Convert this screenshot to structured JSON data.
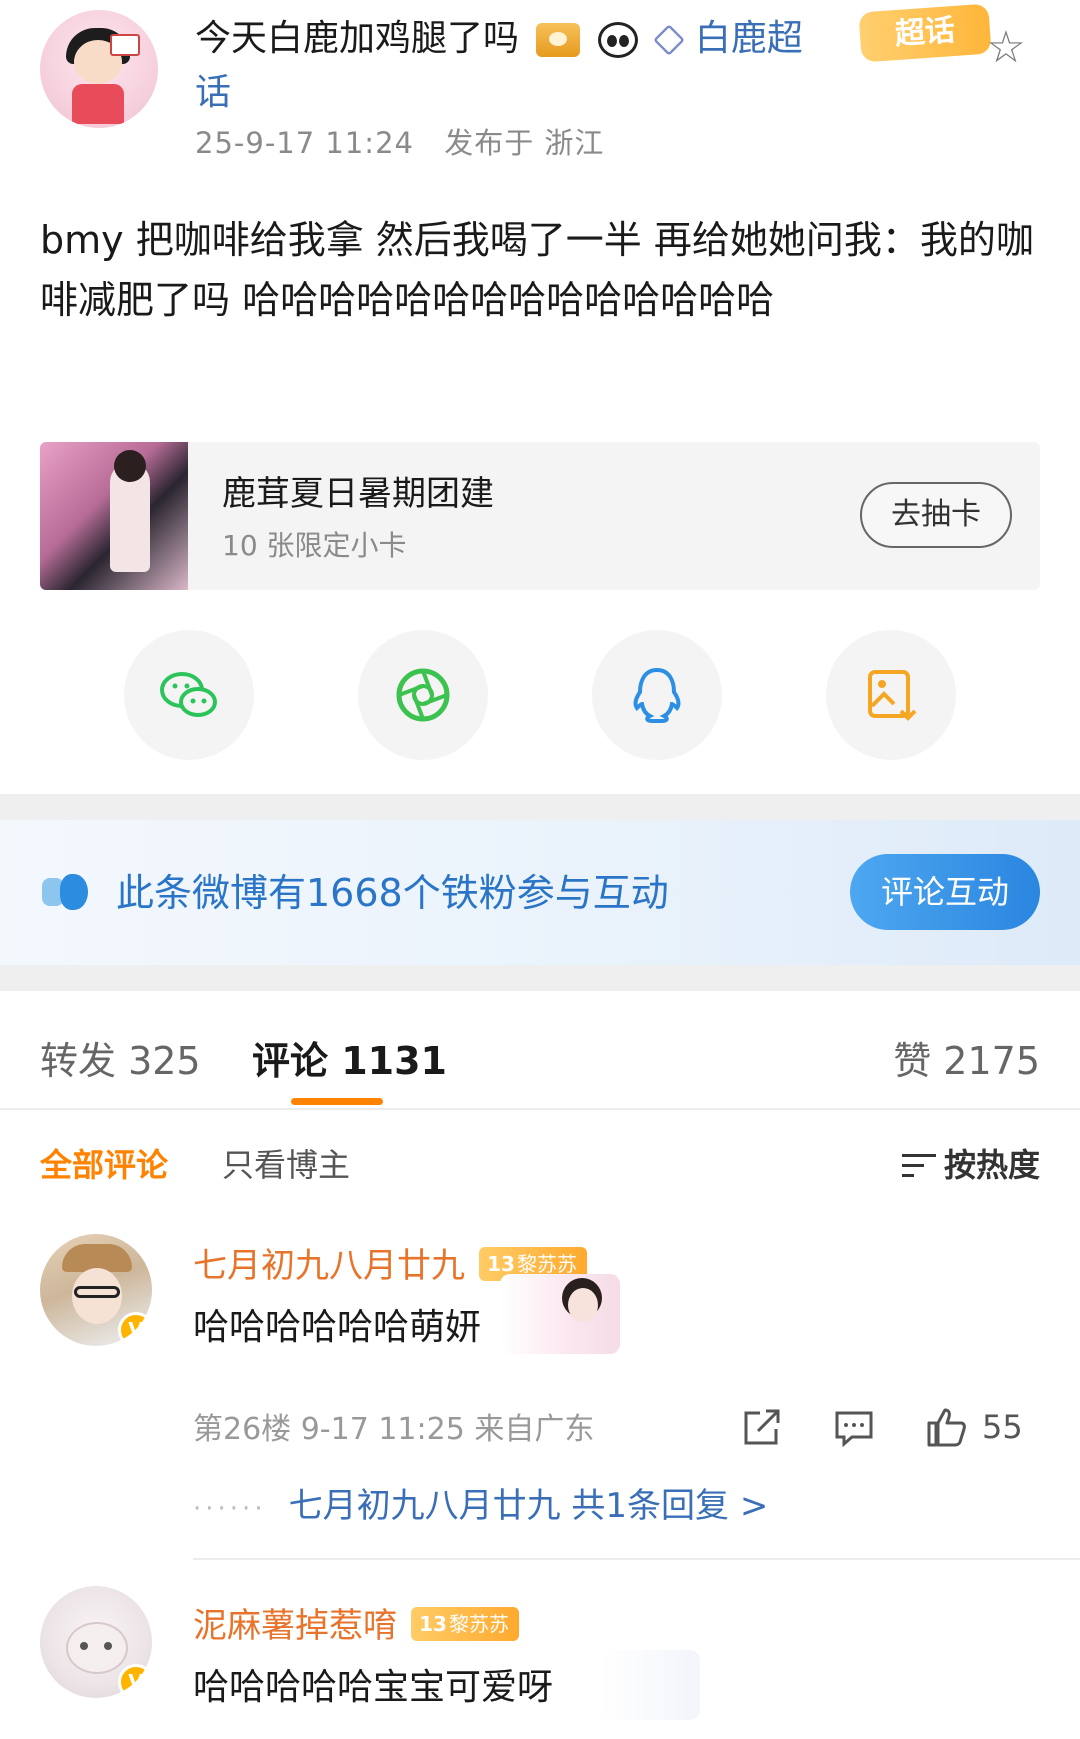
{
  "post": {
    "username": "今天白鹿加鸡腿了吗",
    "topic_link_line1": "白鹿超",
    "topic_link_line2": "话",
    "supertag": "超话",
    "timestamp": "25-9-17 11:24",
    "location": "发布于 浙江",
    "body": "bmy 把咖啡给我拿 然后我喝了一半 再给她她问我：我的咖啡减肥了吗 哈哈哈哈哈哈哈哈哈哈哈哈哈哈"
  },
  "promo": {
    "title": "鹿茸夏日暑期团建",
    "subtitle": "10 张限定小卡",
    "button": "去抽卡"
  },
  "share": {
    "icons": [
      "wechat-icon",
      "moments-icon",
      "qq-icon",
      "save-image-icon"
    ],
    "colors": {
      "wechat": "#2bc45a",
      "moments": "#3cc24e",
      "qq": "#2c8fe4",
      "save": "#f5a623"
    }
  },
  "fans_banner": {
    "text": "此条微博有1668个铁粉参与互动",
    "button": "评论互动"
  },
  "tabs": {
    "repost": "转发 325",
    "comments": "评论 1131",
    "likes": "赞 2175"
  },
  "filters": {
    "all": "全部评论",
    "author_only": "只看博主",
    "sort": "按热度"
  },
  "comments": [
    {
      "name": "七月初九八月廿九",
      "fan_level": "13",
      "fan_group": "黎苏苏",
      "text": "哈哈哈哈哈哈萌妍",
      "meta": "第26楼 9-17 11:25 来自广东",
      "likes": "55",
      "reply_dots": "······",
      "reply_text": "七月初九八月廿九  共1条回复 >"
    },
    {
      "name": "泥麻薯掉惹唷",
      "fan_level": "13",
      "fan_group": "黎苏苏",
      "text": "哈哈哈哈哈宝宝可爱呀"
    }
  ],
  "colors": {
    "accent": "#ff8200",
    "link": "#3a6fb8",
    "banner_text": "#2a75c7",
    "username_orange": "#e8742c"
  }
}
